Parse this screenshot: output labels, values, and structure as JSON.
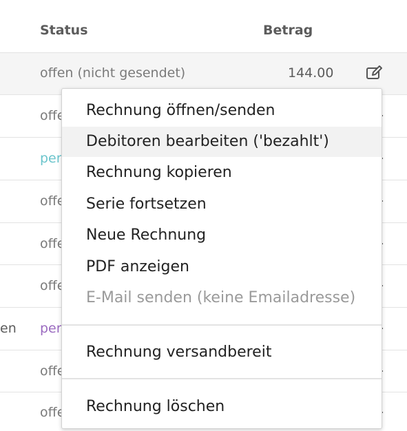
{
  "table": {
    "columns": {
      "status": "Status",
      "betrag": "Betrag"
    },
    "rows": [
      {
        "status": "offen (nicht gesendet)",
        "betrag": "144.00",
        "left": ""
      },
      {
        "status": "offe",
        "betrag": "",
        "left": ""
      },
      {
        "status": "per",
        "betrag": "",
        "left": ""
      },
      {
        "status": "offe",
        "betrag": "",
        "left": ""
      },
      {
        "status": "offe",
        "betrag": "",
        "left": ""
      },
      {
        "status": "offe",
        "betrag": "",
        "left": ""
      },
      {
        "status": "per",
        "betrag": "",
        "left": "en"
      },
      {
        "status": "offe",
        "betrag": "",
        "left": ""
      },
      {
        "status": "offe",
        "betrag": "",
        "left": ""
      }
    ]
  },
  "colors": {
    "status_teal": "#6cc5cc",
    "status_purple": "#9b6bc0"
  },
  "icons": {
    "row_action": "edit-icon"
  },
  "menu": {
    "items": [
      {
        "label": "Rechnung öffnen/senden",
        "enabled": true
      },
      {
        "label": "Debitoren bearbeiten ('bezahlt')",
        "enabled": true
      },
      {
        "label": "Rechnung kopieren",
        "enabled": true
      },
      {
        "label": "Serie fortsetzen",
        "enabled": true
      },
      {
        "label": "Neue Rechnung",
        "enabled": true
      },
      {
        "label": "PDF anzeigen",
        "enabled": true
      },
      {
        "label": "E-Mail senden (keine Emailadresse)",
        "enabled": false
      },
      {
        "label": "Rechnung versandbereit",
        "enabled": true
      },
      {
        "label": "Rechnung löschen",
        "enabled": true
      }
    ]
  }
}
